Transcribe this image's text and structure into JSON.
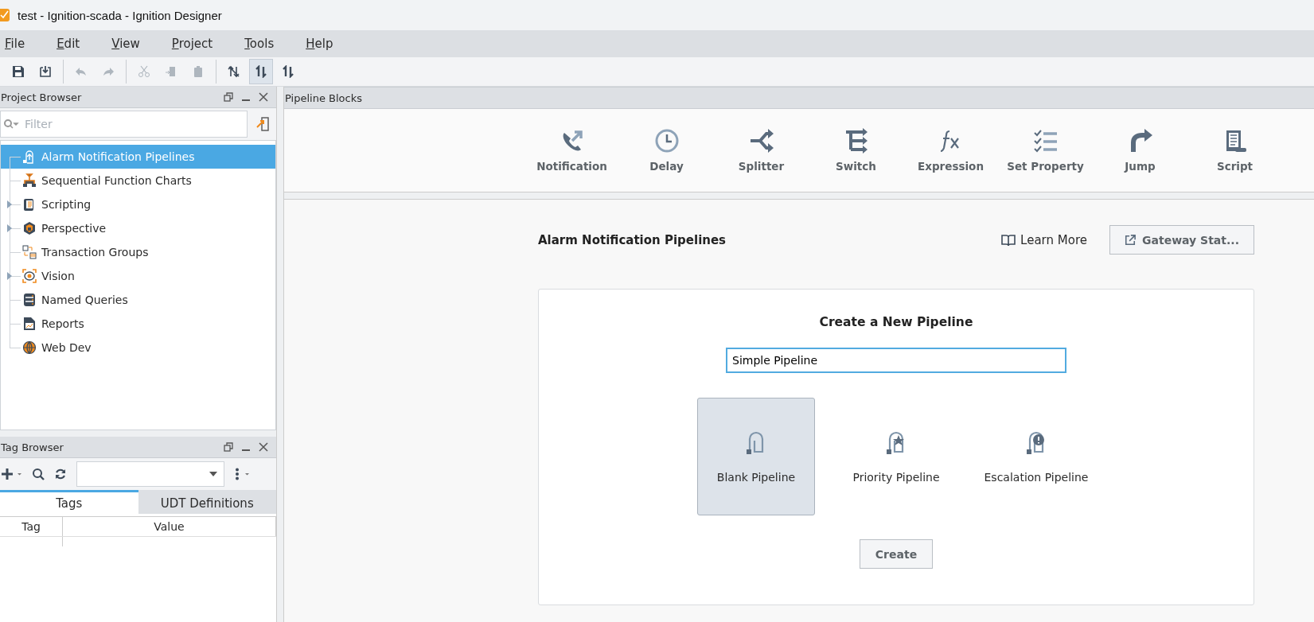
{
  "window": {
    "title": "test - Ignition-scada - Ignition Designer"
  },
  "menu": [
    {
      "label": "File"
    },
    {
      "label": "Edit"
    },
    {
      "label": "View"
    },
    {
      "label": "Project"
    },
    {
      "label": "Tools"
    },
    {
      "label": "Help"
    }
  ],
  "toolbar": [
    {
      "disabled": false,
      "selected": false
    },
    {
      "disabled": false,
      "selected": false
    },
    {
      "disabled": true,
      "selected": false
    },
    {
      "disabled": true,
      "selected": false
    },
    {
      "disabled": true,
      "selected": false
    },
    {
      "disabled": true,
      "selected": false
    },
    {
      "disabled": true,
      "selected": false
    },
    {
      "disabled": false,
      "selected": false
    },
    {
      "disabled": false,
      "selected": true
    },
    {
      "disabled": false,
      "selected": false
    }
  ],
  "project_browser": {
    "title": "Project Browser",
    "filter": {
      "placeholder": "Filter"
    },
    "items": [
      {
        "label": "Alarm Notification Pipelines",
        "kind": "leaf",
        "selected": true
      },
      {
        "label": "Sequential Function Charts",
        "kind": "leaf",
        "selected": false
      },
      {
        "label": "Scripting",
        "kind": "folder",
        "selected": false
      },
      {
        "label": "Perspective",
        "kind": "folder",
        "selected": false
      },
      {
        "label": "Transaction Groups",
        "kind": "leaf",
        "selected": false
      },
      {
        "label": "Vision",
        "kind": "folder",
        "selected": false
      },
      {
        "label": "Named Queries",
        "kind": "leaf",
        "selected": false
      },
      {
        "label": "Reports",
        "kind": "leaf",
        "selected": false
      },
      {
        "label": "Web Dev",
        "kind": "leaf",
        "selected": false
      }
    ]
  },
  "tag_browser": {
    "title": "Tag Browser",
    "tabs": [
      {
        "label": "Tags",
        "selected": true
      },
      {
        "label": "UDT Definitions",
        "selected": false
      }
    ],
    "columns": [
      "Tag",
      "Value"
    ]
  },
  "pipeline_blocks": {
    "title": "Pipeline Blocks",
    "blocks": [
      "Notification",
      "Delay",
      "Splitter",
      "Switch",
      "Expression",
      "Set Property",
      "Jump",
      "Script"
    ]
  },
  "editor": {
    "title": "Alarm Notification Pipelines",
    "learn_more": "Learn More",
    "gateway_button": "Gateway Stat...",
    "card": {
      "heading": "Create a New Pipeline",
      "name_field": {
        "value": "Simple Pipeline"
      },
      "templates": [
        {
          "label": "Blank Pipeline",
          "selected": true
        },
        {
          "label": "Priority Pipeline",
          "selected": false
        },
        {
          "label": "Escalation Pipeline",
          "selected": false
        }
      ],
      "create_button": "Create"
    }
  }
}
